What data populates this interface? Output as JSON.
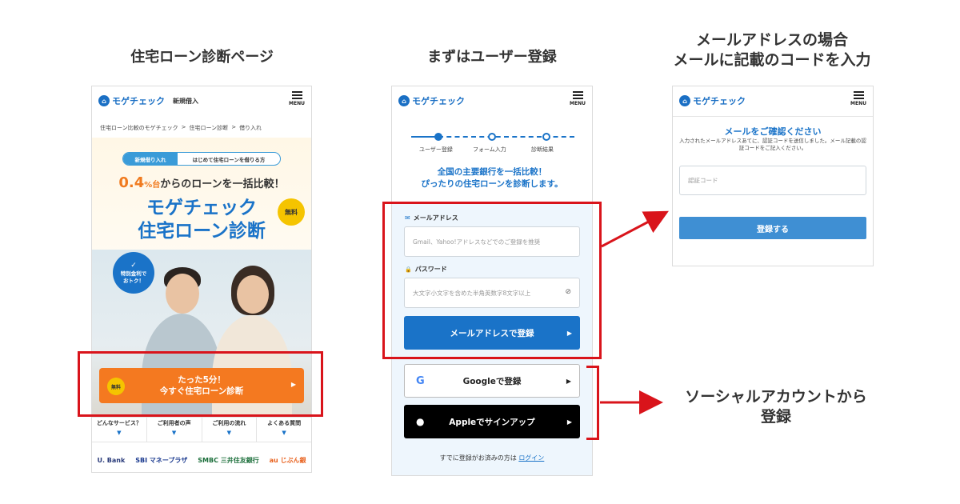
{
  "captions": {
    "col1": "住宅ローン診断ページ",
    "col2": "まずはユーザー登録",
    "col3_line1": "メールアドレスの場合",
    "col3_line2": "メールに記載のコードを入力",
    "social_line1": "ソーシャルアカウントから",
    "social_line2": "登録"
  },
  "brand": {
    "logo": "モゲチェック",
    "menu_label": "MENU"
  },
  "phone1": {
    "subheader": "新規借入",
    "breadcrumb": [
      "住宅ローン比較のモゲチェック",
      ">",
      "住宅ローン診断",
      ">",
      "借り入れ"
    ],
    "tabs": [
      "新規借り入れ",
      "はじめて住宅ローンを借りる方"
    ],
    "rate_num": "0.4",
    "rate_pct": "%台",
    "rate_rest": "からのローンを一括比較！",
    "title_line1": "モゲチェック",
    "title_line2": "住宅ローン診断",
    "free_badge": "無料",
    "speech_check": "✓",
    "speech_line1": "特別金利で",
    "speech_line2": "おトク！",
    "cta_free": "無料",
    "cta_line1": "たった5分！",
    "cta_line2": "今すぐ住宅ローン診断",
    "cta_arrow": "▶",
    "nav": [
      {
        "label": "どんなサービス？",
        "arrow": "▼"
      },
      {
        "label": "ご利用者の声",
        "arrow": "▼"
      },
      {
        "label": "ご利用の流れ",
        "arrow": "▼"
      },
      {
        "label": "よくある質問",
        "arrow": "▼"
      }
    ],
    "banks": [
      "U. Bank",
      "SBI マネープラザ",
      "SMBC 三井住友銀行",
      "au じぶん銀"
    ]
  },
  "phone2": {
    "steps": [
      "ユーザー登録",
      "フォーム入力",
      "診断結果"
    ],
    "lead_line1": "全国の主要銀行を一括比較！",
    "lead_line2": "ぴったりの住宅ローンを診断します。",
    "email_label": "メールアドレス",
    "email_icon": "✉",
    "email_placeholder": "Gmail、Yahoo!アドレスなどでのご登録を推奨",
    "password_label": "パスワード",
    "password_icon": "🔒",
    "password_placeholder": "大文字小文字を含めた半角英数字8文字以上",
    "eye_icon": "⊘",
    "email_button": "メールアドレスで登録",
    "google_icon": "G",
    "google_button": "Googleで登録",
    "apple_icon": "",
    "apple_button": "Appleでサインアップ",
    "arrow": "▶",
    "login_prefix": "すでに登録がお済みの方は",
    "login_link": "ログイン"
  },
  "phone3": {
    "title": "メールをご確認ください",
    "desc": "入力されたメールアドレスあてに、認証コードを送信しました。メール記載の認証コードをご記入ください。",
    "code_placeholder": "認証コード",
    "submit": "登録する"
  },
  "colors": {
    "accent": "#1a73c8",
    "cta": "#f47920",
    "annotation": "#d9141b"
  }
}
